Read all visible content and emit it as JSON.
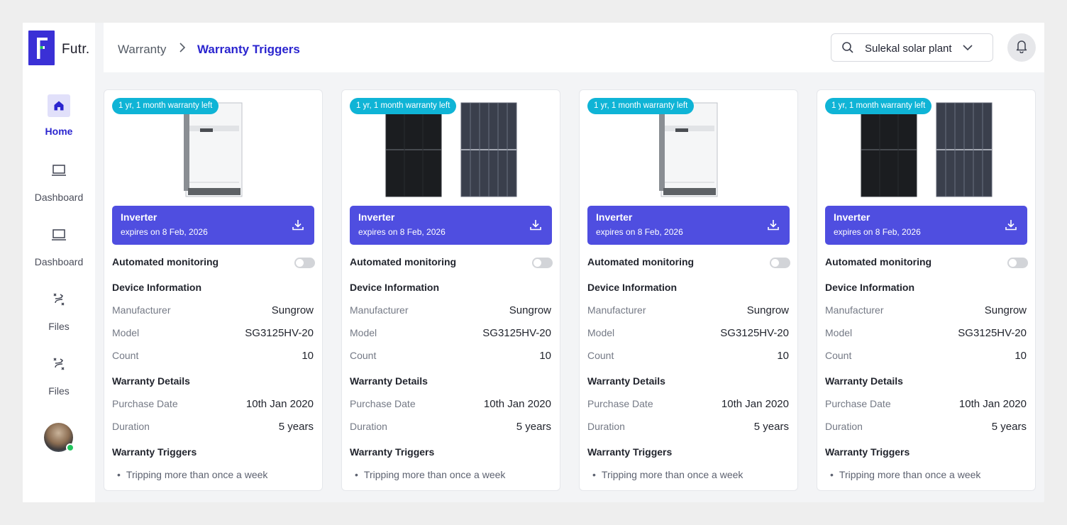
{
  "app": {
    "logo_text": "Futr."
  },
  "sidebar": {
    "items": [
      {
        "label": "Home",
        "icon": "home-icon",
        "active": true
      },
      {
        "label": "Dashboard",
        "icon": "laptop-icon",
        "active": false
      },
      {
        "label": "Dashboard",
        "icon": "laptop-icon",
        "active": false
      },
      {
        "label": "Files",
        "icon": "route-icon",
        "active": false
      },
      {
        "label": "Files",
        "icon": "route-icon",
        "active": false
      }
    ]
  },
  "header": {
    "breadcrumb_root": "Warranty",
    "breadcrumb_current": "Warranty Triggers",
    "plant_select_value": "Sulekal solar plant"
  },
  "labels": {
    "automated_monitoring": "Automated monitoring",
    "device_information": "Device Information",
    "manufacturer": "Manufacturer",
    "model": "Model",
    "count": "Count",
    "warranty_details": "Warranty Details",
    "purchase_date": "Purchase Date",
    "duration": "Duration",
    "warranty_triggers": "Warranty Triggers"
  },
  "cards": [
    {
      "badge": "1 yr, 1 month warranty left",
      "image": "inverter",
      "title": "Inverter",
      "expiry": "expires on 8 Feb, 2026",
      "monitoring": false,
      "manufacturer": "Sungrow",
      "model": "SG3125HV-20",
      "count": "10",
      "purchase_date": "10th Jan 2020",
      "duration": "5 years",
      "trigger": "Tripping more than once a week"
    },
    {
      "badge": "1 yr, 1 month warranty left",
      "image": "solar-panels",
      "title": "Inverter",
      "expiry": "expires on 8 Feb, 2026",
      "monitoring": false,
      "manufacturer": "Sungrow",
      "model": "SG3125HV-20",
      "count": "10",
      "purchase_date": "10th Jan 2020",
      "duration": "5 years",
      "trigger": "Tripping more than once a week"
    },
    {
      "badge": "1 yr, 1 month warranty left",
      "image": "inverter",
      "title": "Inverter",
      "expiry": "expires on 8 Feb, 2026",
      "monitoring": false,
      "manufacturer": "Sungrow",
      "model": "SG3125HV-20",
      "count": "10",
      "purchase_date": "10th Jan 2020",
      "duration": "5 years",
      "trigger": "Tripping more than once a week"
    },
    {
      "badge": "1 yr, 1 month warranty left",
      "image": "solar-panels",
      "title": "Inverter",
      "expiry": "expires on 8 Feb, 2026",
      "monitoring": false,
      "manufacturer": "Sungrow",
      "model": "SG3125HV-20",
      "count": "10",
      "purchase_date": "10th Jan 2020",
      "duration": "5 years",
      "trigger": "Tripping more than once a week"
    }
  ],
  "colors": {
    "brand": "#3a30d6",
    "banner": "#4f4ee0",
    "badge": "#0fb4d6",
    "online": "#22c55e"
  }
}
